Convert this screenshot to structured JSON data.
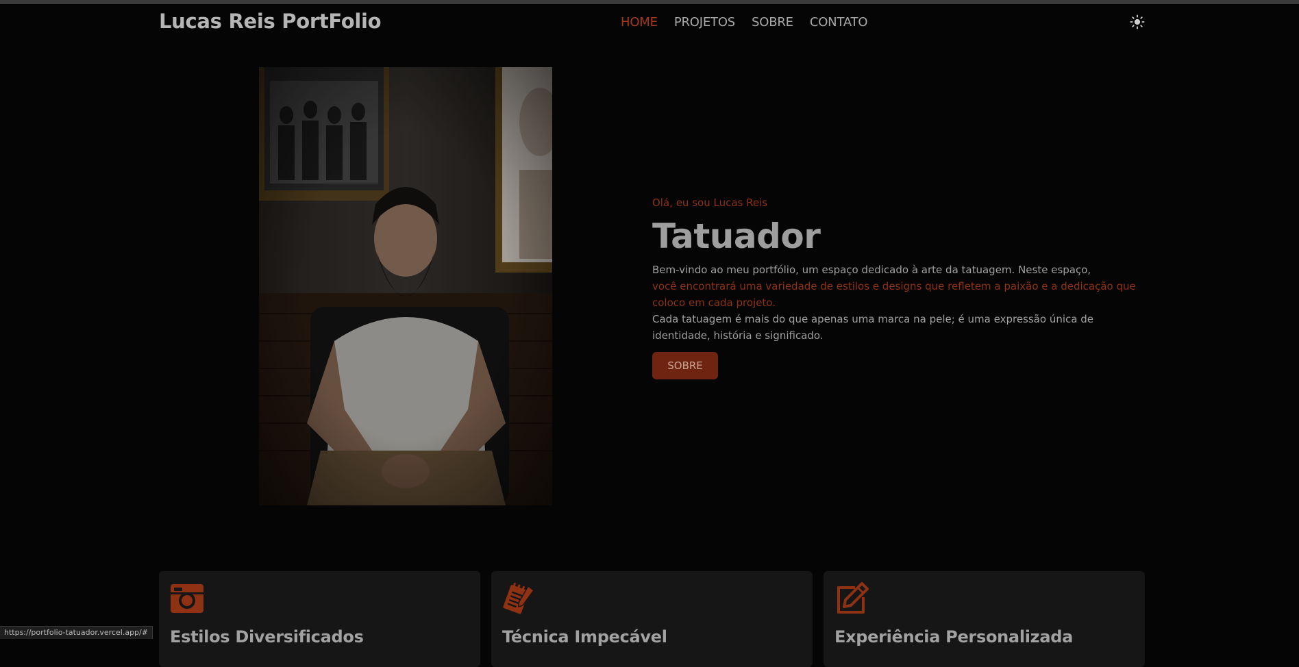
{
  "header": {
    "brand": "Lucas Reis PortFolio",
    "nav": [
      {
        "label": "HOME",
        "active": true
      },
      {
        "label": "PROJETOS",
        "active": false
      },
      {
        "label": "SOBRE",
        "active": false
      },
      {
        "label": "CONTATO",
        "active": false
      }
    ],
    "theme_icon": "sun-icon"
  },
  "hero": {
    "greeting": "Olá, eu sou Lucas Reis",
    "title": "Tatuador",
    "intro_line1": "Bem-vindo ao meu portfólio, um espaço dedicado à arte da tatuagem. Neste espaço,",
    "intro_accent": "você encontrará uma variedade de estilos e designs que refletem a paixão e a dedicação que coloco em cada projeto.",
    "intro_line3": "Cada tatuagem é mais do que apenas uma marca na pele; é uma expressão única de identidade, história e significado.",
    "button_label": "SOBRE"
  },
  "cards": [
    {
      "icon": "camera-icon",
      "title": "Estilos Diversificados"
    },
    {
      "icon": "notepad-pencil-icon",
      "title": "Técnica Impecável"
    },
    {
      "icon": "edit-square-icon",
      "title": "Experiência Personalizada"
    }
  ],
  "statusbar": {
    "url": "https://portfolio-tatuador.vercel.app/#"
  },
  "colors": {
    "accent": "#a6391a",
    "background": "#050505",
    "card": "#161616",
    "button": "#6e2410"
  }
}
